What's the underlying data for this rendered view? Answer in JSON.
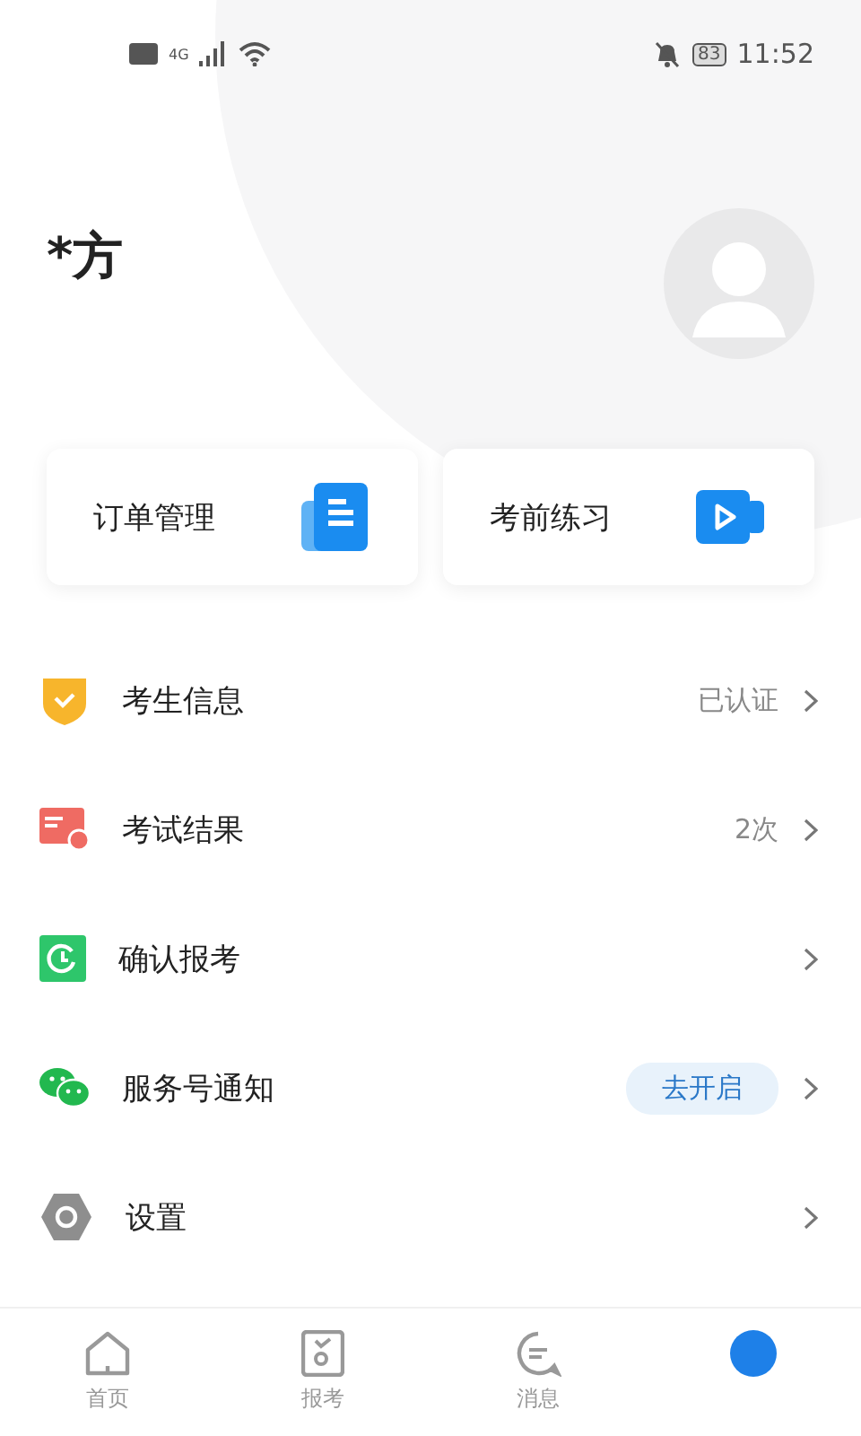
{
  "status_bar": {
    "network": "4G",
    "battery": "83",
    "time": "11:52"
  },
  "profile": {
    "name": "*方"
  },
  "cards": [
    {
      "label": "订单管理",
      "kind": "document"
    },
    {
      "label": "考前练习",
      "kind": "video"
    }
  ],
  "menu": [
    {
      "label": "考生信息",
      "kind": "shield",
      "value": "已认证"
    },
    {
      "label": "考试结果",
      "kind": "result",
      "value": "2次"
    },
    {
      "label": "确认报考",
      "kind": "clock"
    },
    {
      "label": "服务号通知",
      "kind": "chat",
      "action": "去开启"
    },
    {
      "label": "设置",
      "kind": "gear"
    }
  ],
  "tabs": [
    {
      "label": "首页",
      "kind": "home",
      "selected": false
    },
    {
      "label": "报考",
      "kind": "apply",
      "selected": false
    },
    {
      "label": "消息",
      "kind": "message",
      "selected": false
    },
    {
      "kind": "mine",
      "selected": true
    }
  ]
}
